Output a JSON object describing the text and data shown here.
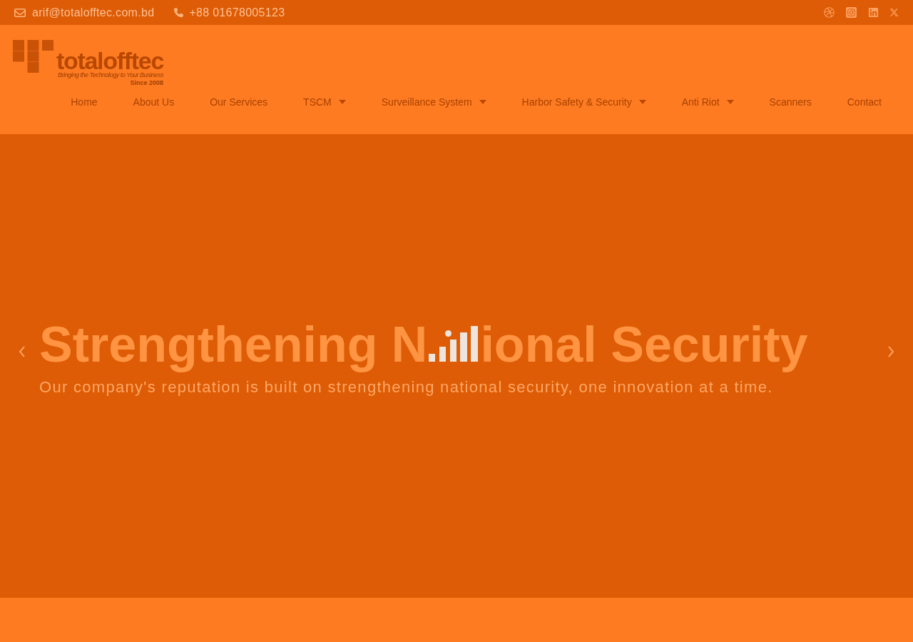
{
  "top_bar": {
    "email": "arif@totalofftec.com.bd",
    "phone": "+88 01678005123"
  },
  "header": {
    "logo": {
      "wordmark": "totalofftec",
      "tagline": "Bringing the Technology to Your Business",
      "since": "Since 2008"
    },
    "nav": [
      {
        "label": "Home",
        "has_dropdown": false
      },
      {
        "label": "About Us",
        "has_dropdown": false
      },
      {
        "label": "Our Services",
        "has_dropdown": false
      },
      {
        "label": "TSCM",
        "has_dropdown": true
      },
      {
        "label": "Surveillance System",
        "has_dropdown": true
      },
      {
        "label": "Harbor Safety & Security",
        "has_dropdown": true
      },
      {
        "label": "Anti Riot",
        "has_dropdown": true
      },
      {
        "label": "Scanners",
        "has_dropdown": false
      },
      {
        "label": "Contact",
        "has_dropdown": false
      }
    ]
  },
  "hero": {
    "title_before_loader": "Strengthening N",
    "title_after_loader": "ional Security",
    "subtitle": "Our company's reputation is built on strengthening national security, one innovation at a time."
  }
}
